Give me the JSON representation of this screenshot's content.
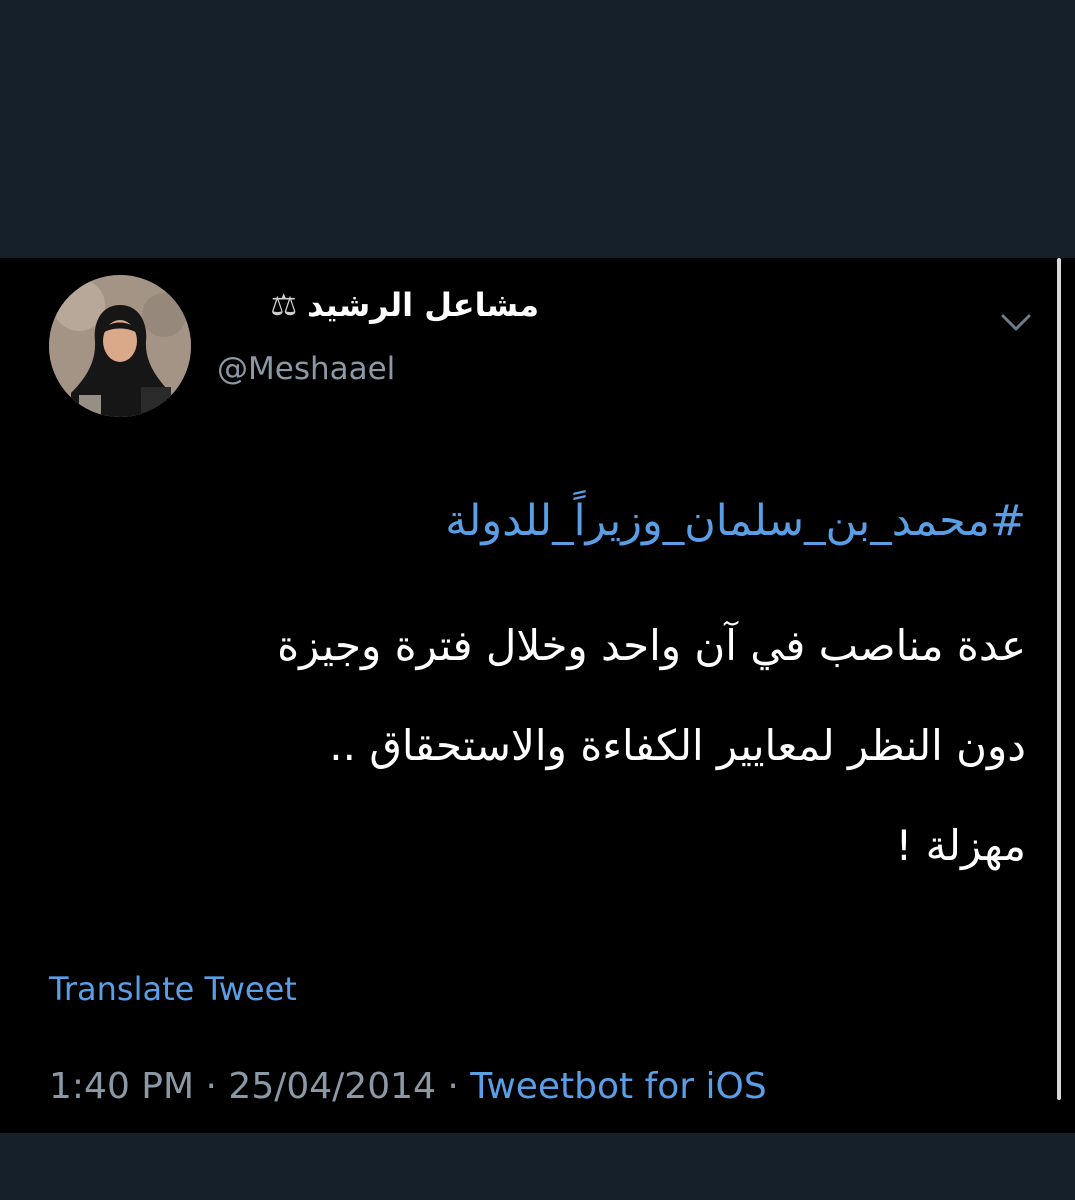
{
  "tweet": {
    "display_name": "مشاعل الرشيد",
    "name_badge_icon": "scales-icon",
    "handle": "@Meshaael",
    "hashtag": "#محمد_بن_سلمان_وزيراً_للدولة",
    "lines": [
      "عدة مناصب في آن واحد وخلال فترة وجيزة",
      "دون النظر لمعايير الكفاءة والاستحقاق ..",
      "مهزلة !"
    ],
    "translate_label": "Translate Tweet",
    "time": "1:40 PM",
    "separator": "·",
    "date": "25/04/2014",
    "source": "Tweetbot for iOS"
  },
  "colors": {
    "page_background": "#15202b",
    "card_background": "#000000",
    "link": "#5a9ee6",
    "secondary_text": "#8b98a5"
  }
}
